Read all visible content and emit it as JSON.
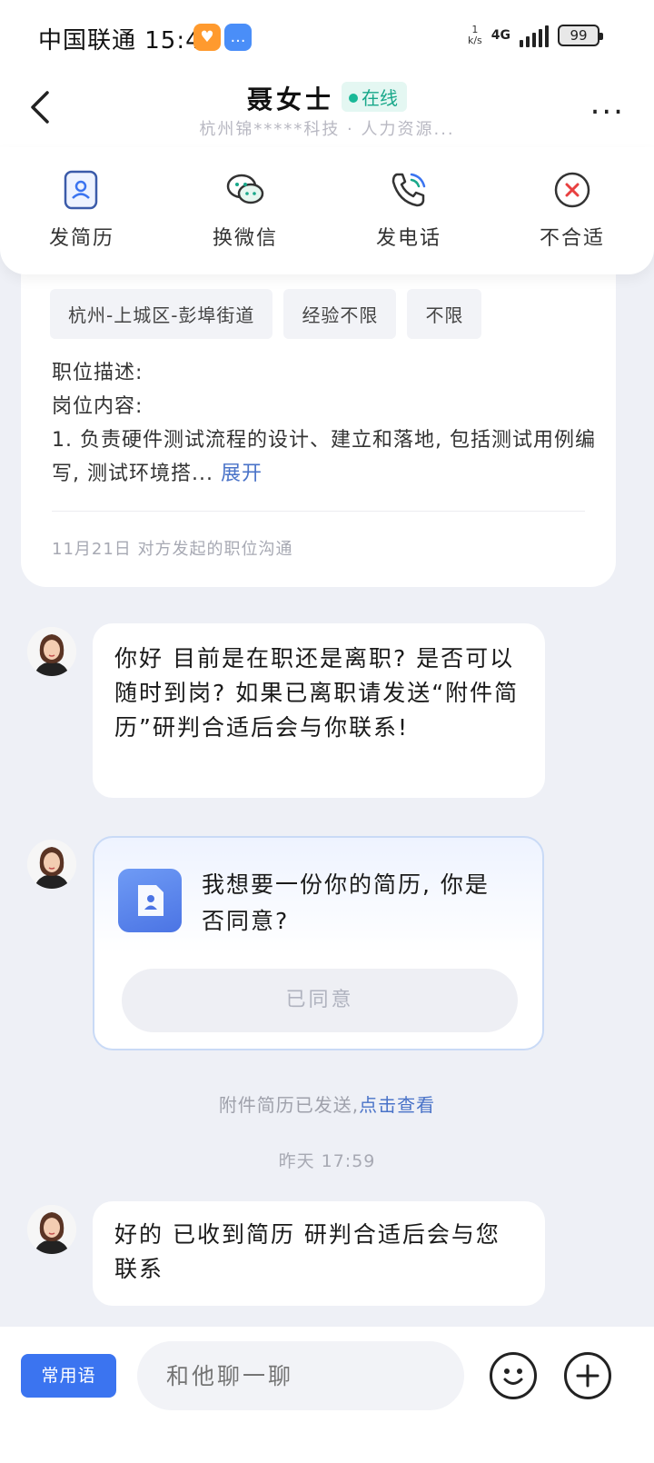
{
  "status_bar": {
    "carrier_time": "中国联通 15:40",
    "speed_value": "1",
    "speed_unit": "k/s",
    "network": "4G",
    "battery": "99"
  },
  "header": {
    "title": "聂女士",
    "online_label": "在线",
    "subtitle": "杭州锦*****科技 · 人力资源...",
    "more_label": "..."
  },
  "actions": [
    {
      "label": "发简历",
      "icon": "resume-icon"
    },
    {
      "label": "换微信",
      "icon": "wechat-icon"
    },
    {
      "label": "发电话",
      "icon": "phone-icon"
    },
    {
      "label": "不合适",
      "icon": "reject-icon"
    }
  ],
  "job": {
    "tags": [
      "杭州-上城区-彭埠街道",
      "经验不限",
      "不限"
    ],
    "desc_line1": "职位描述:",
    "desc_line2": "岗位内容:",
    "desc_line3": "1. 负责硬件测试流程的设计、建立和落地, 包括测试用例编写, 测试环境搭...",
    "expand_label": "展开",
    "meta": "11月21日 对方发起的职位沟通"
  },
  "messages": {
    "msg1": "你好 目前是在职还是离职? 是否可以随时到岗? 如果已离职请发送“附件简历”研判合适后会与你联系!",
    "resume_request": "我想要一份你的简历, 你是否同意?",
    "agree_label": "已同意",
    "sent_note": "附件简历已发送,",
    "view_link": "点击查看",
    "timestamp": "昨天 17:59",
    "msg3": "好的 已收到简历 研判合适后会与您联系"
  },
  "input_bar": {
    "phrases_label": "常用语",
    "placeholder": "和他聊一聊"
  },
  "colors": {
    "accent": "#3b74f0",
    "online": "#19a88a",
    "link": "#4a73c8",
    "reject": "#e84040"
  }
}
